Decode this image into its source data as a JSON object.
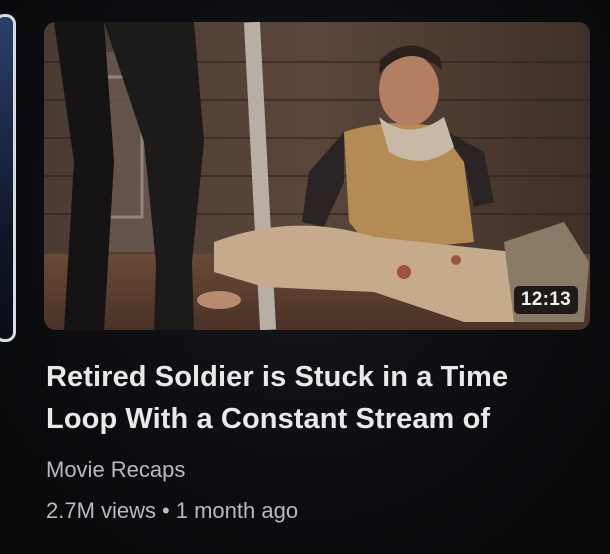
{
  "video": {
    "title": "Retired Soldier is Stuck in a Time Loop With a Constant Stream of",
    "duration": "12:13",
    "channel": "Movie Recaps",
    "views": "2.7M views",
    "separator": "•",
    "age": "1 month ago"
  }
}
